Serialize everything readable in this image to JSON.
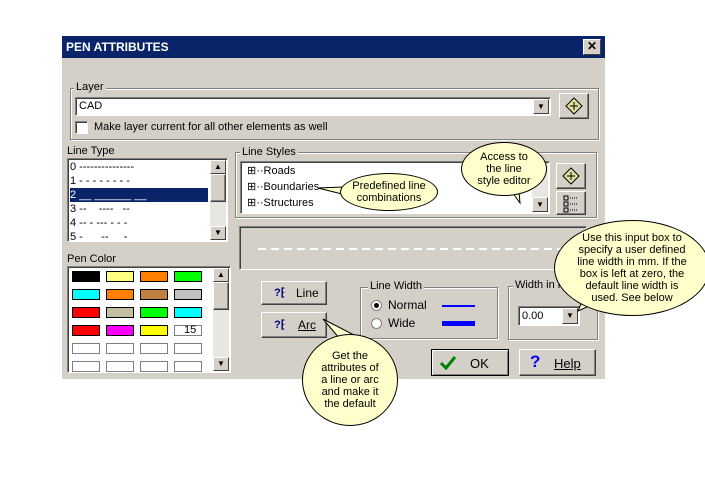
{
  "dialog": {
    "title": "PEN ATTRIBUTES",
    "close_glyph": "✕"
  },
  "layer": {
    "group_label": "Layer",
    "value": "CAD",
    "checkbox_label": "Make layer current for all other elements as well"
  },
  "line_type": {
    "label": "Line Type",
    "items": [
      "0 ---------------",
      "1 - - - - - - - -",
      "2 __ ______ __",
      "3 --    ----   --",
      "4 -- - --- - - -",
      "5 -      --     -"
    ],
    "selected_index": 2
  },
  "pen_color": {
    "label": "Pen Color",
    "rows": [
      [
        "#000000",
        "#ffff80",
        "#ff8000",
        "#00ff00"
      ],
      [
        "#00ffff",
        "#ff8000",
        "#c08040",
        "#c0c0c0"
      ],
      [
        "#ff0000",
        "#c0c0a0",
        "#00ff00",
        "#00ffff"
      ],
      [
        "#ff0000",
        "#ff00ff",
        "#ffff00",
        "#ffffff"
      ],
      [
        "#ffffff",
        "#ffffff",
        "#ffffff",
        "#ffffff"
      ],
      [
        "#ffffff",
        "#ffffff",
        "#ffffff",
        "#ffffff"
      ]
    ],
    "numbered_cell_text": "15"
  },
  "line_styles": {
    "label": "Line Styles",
    "items": [
      "Roads",
      "Boundaries",
      "Structures"
    ]
  },
  "buttons": {
    "line": "Line",
    "arc": "Arc",
    "ok": "OK",
    "help": "Help"
  },
  "line_width": {
    "label": "Line Width",
    "normal": "Normal",
    "wide": "Wide",
    "selected": "Normal"
  },
  "width_in_mm": {
    "label": "Width in m",
    "value": "0.00"
  },
  "callouts": {
    "styles": "Predefined line combinations",
    "editor": "Access to the line style editor",
    "width": "Use this input box to specify a user defined line width in mm. If the box is left at zero, the default line width is used. See below",
    "attributes": "Get the attributes of a line or arc and make it the default"
  },
  "colors": {
    "title_bar": "#0a246a",
    "dialog": "#d4d0c8",
    "callout": "#ffffcc",
    "ok_check": "#008000",
    "help_mark": "#0000ff"
  }
}
